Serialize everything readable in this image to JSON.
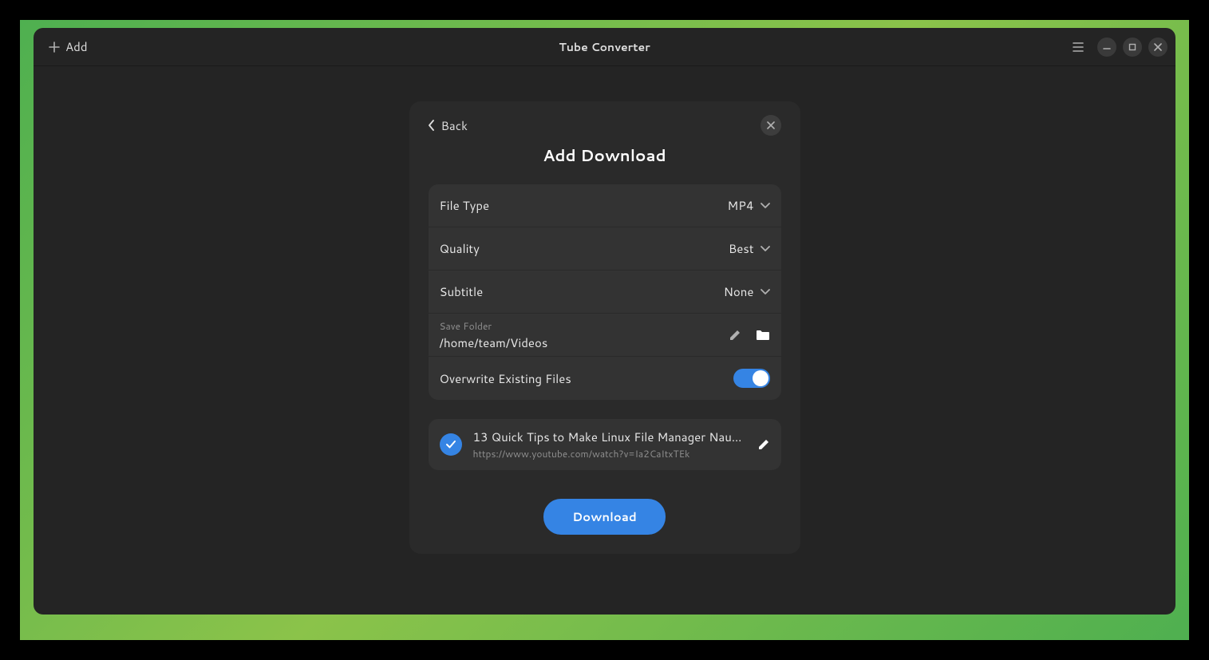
{
  "titlebar": {
    "add_label": "Add",
    "app_title": "Tube Converter"
  },
  "dialog": {
    "back_label": "Back",
    "title": "Add Download",
    "rows": {
      "file_type": {
        "label": "File Type",
        "value": "MP4"
      },
      "quality": {
        "label": "Quality",
        "value": "Best"
      },
      "subtitle": {
        "label": "Subtitle",
        "value": "None"
      },
      "save_folder": {
        "label": "Save Folder",
        "path": "/home/team/Videos"
      },
      "overwrite": {
        "label": "Overwrite Existing Files",
        "on": true
      }
    },
    "video": {
      "title": "13 Quick Tips to Make Linux File Manager Nautil…",
      "url": "https://www.youtube.com/watch?v=Ia2CaItxTEk"
    },
    "download_label": "Download"
  }
}
